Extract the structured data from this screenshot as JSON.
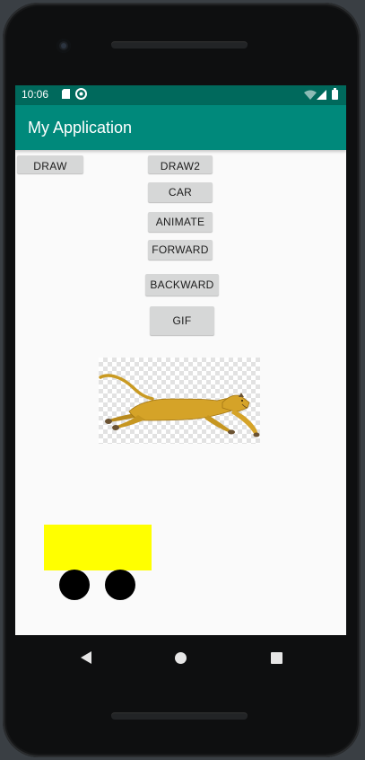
{
  "status_bar": {
    "time": "10:06",
    "left_icons": [
      "sd-card-icon",
      "sync-icon"
    ],
    "right_icons": [
      "wifi-icon",
      "signal-icon",
      "battery-icon"
    ],
    "color": "#00695c"
  },
  "app_bar": {
    "title": "My Application",
    "color": "#00897b"
  },
  "buttons": {
    "draw": "DRAW",
    "draw2": "DRAW2",
    "car": "CAR",
    "animate": "ANIMATE",
    "forward": "FORWARD",
    "backward": "BACKWARD",
    "gif": "GIF"
  },
  "gif_image": {
    "subject": "running cougar",
    "icon": "cougar-icon"
  },
  "car": {
    "body_color": "#ffff00",
    "wheel_color": "#000000"
  },
  "nav_bar": {
    "icons": [
      "back-icon",
      "home-icon",
      "recents-icon"
    ]
  }
}
